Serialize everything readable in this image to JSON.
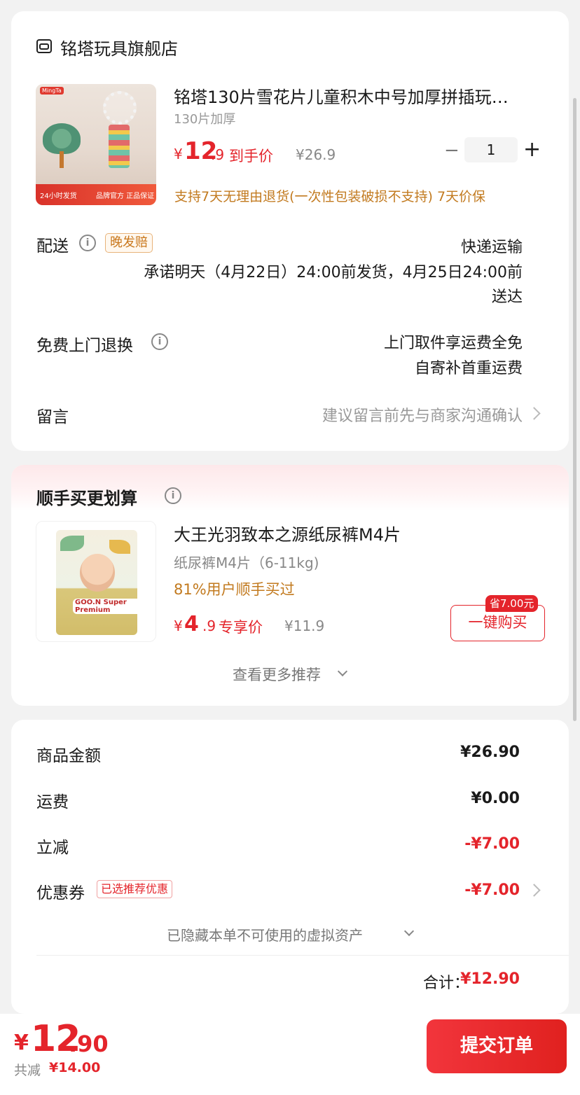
{
  "store": {
    "name": "铭塔玩具旗舰店",
    "product": {
      "title": "铭塔130片雪花片儿童积木中号加厚拼插玩…",
      "spec": "130片加厚",
      "price_symbol": "¥",
      "price_int": "12",
      "price_dec": ".9",
      "price_label": "到手价",
      "original_price": "¥26.9",
      "quantity": "1",
      "qty_minus": "−",
      "qty_plus": "+",
      "guarantee": "支持7天无理由退货(一次性包装破损不支持)  7天价保",
      "image_badges": [
        "24小时发货",
        "品牌官方 正品保证"
      ],
      "image_brand": "MingTa"
    },
    "delivery": {
      "label": "配送",
      "tag": "晚发赔",
      "method": "快递运输",
      "promise_line1": "承诺明天（4月22日）24:00前发货，4月25日24:00前",
      "promise_line2": "送达"
    },
    "returns": {
      "label": "免费上门退换",
      "line1": "上门取件享运费全免",
      "line2": "自寄补首重运费"
    },
    "message": {
      "label": "留言",
      "placeholder": "建议留言前先与商家沟通确认"
    }
  },
  "recommend": {
    "title": "顺手买更划算",
    "item": {
      "title": "大王光羽致本之源纸尿裤M4片",
      "spec": "纸尿裤M4片（6-11kg)",
      "bought": "81%用户顺手买过",
      "price_symbol": "¥",
      "price_int": "4",
      "price_dec": ".9",
      "price_label": "专享价",
      "original_price": "¥11.9",
      "save_tag": "省7.00元",
      "buy_button": "一键购买",
      "image_logo": "GOO.N Super Premium"
    },
    "more": "查看更多推荐"
  },
  "summary": {
    "rows": [
      {
        "label": "商品金额",
        "value": "¥26.90"
      },
      {
        "label": "运费",
        "value": "¥0.00"
      },
      {
        "label": "立减",
        "value": "-¥7.00"
      },
      {
        "label": "优惠券",
        "value": "-¥7.00"
      }
    ],
    "coupon_tag": "已选推荐优惠",
    "hidden_note": "已隐藏本单不可使用的虚拟资产",
    "total_label": "合计：",
    "total_value": "¥12.90"
  },
  "bottom": {
    "price_symbol": "¥",
    "price_int": "12",
    "price_dec": ".90",
    "saved_label": "共减",
    "saved_value": "¥14.00",
    "submit": "提交订单"
  },
  "colors": {
    "accent_red": "#e4242b",
    "promo_orange": "#c27a1f",
    "background": "#f2f2f2"
  }
}
